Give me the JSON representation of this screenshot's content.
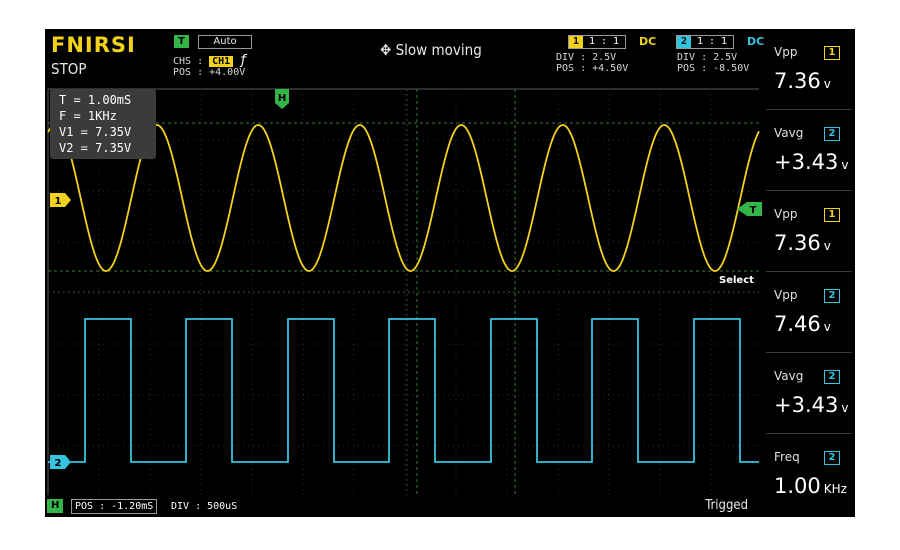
{
  "header": {
    "brand": "FNIRSI",
    "run_state": "STOP",
    "trigger_badge": "T",
    "trigger_mode": "Auto",
    "chs_label": "CHS :",
    "chs_value": "CH1",
    "edge_symbol": "ƒ",
    "pos_label": "POS : +4.00V",
    "mode_icon": "move-cross-icon",
    "mode_text": "Slow moving"
  },
  "channels": [
    {
      "num": "1",
      "ratio": "1 : 1",
      "coupling": "DC",
      "div": "DIV :  2.5V",
      "pos": "POS : +4.50V",
      "color": "#f2d21a"
    },
    {
      "num": "2",
      "ratio": "1 : 1",
      "coupling": "DC",
      "div": "DIV :  2.5V",
      "pos": "POS : -8.50V",
      "color": "#35c4e0"
    }
  ],
  "cursor_readout": {
    "t": "T = 1.00mS",
    "f": "F = 1KHz",
    "v1": "V1 = 7.35V",
    "v2": "V2 = 7.35V"
  },
  "markers": {
    "h": "H",
    "ch1": "1",
    "ch2": "2",
    "trigger": "T",
    "select": "Select"
  },
  "measurements": [
    {
      "name": "Vpp",
      "ch": "1",
      "value": "7.36",
      "unit": "v"
    },
    {
      "name": "Vavg",
      "ch": "2",
      "value": "+3.43",
      "unit": "v"
    },
    {
      "name": "Vpp",
      "ch": "1",
      "value": "7.36",
      "unit": "v"
    },
    {
      "name": "Vpp",
      "ch": "2",
      "value": "7.46",
      "unit": "v"
    },
    {
      "name": "Vavg",
      "ch": "2",
      "value": "+3.43",
      "unit": "v"
    },
    {
      "name": "Freq",
      "ch": "2",
      "value": "1.00",
      "unit": "KHz"
    }
  ],
  "bottom": {
    "h_badge": "H",
    "h_pos": "POS : -1.20mS",
    "div": "DIV : 500uS",
    "status": "Trigged"
  },
  "colors": {
    "ch1": "#f2d21a",
    "ch2": "#35c4e0",
    "accent_green": "#33b54a",
    "grid": "#3d7a3d"
  }
}
